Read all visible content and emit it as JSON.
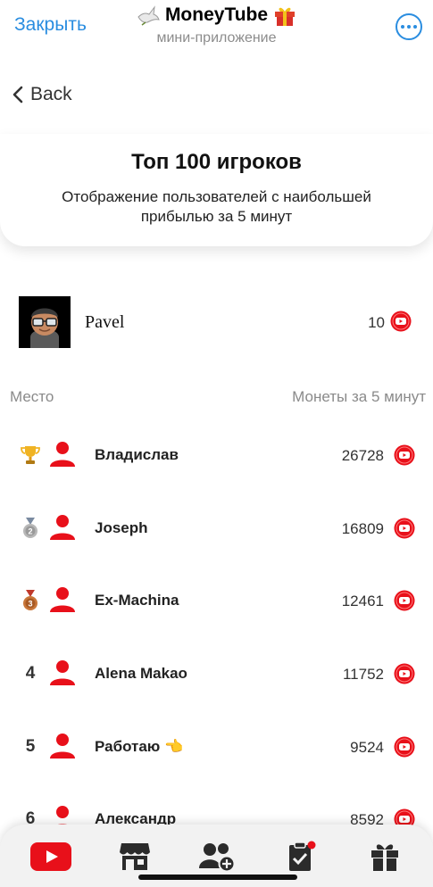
{
  "topbar": {
    "close_label": "Закрыть",
    "app_title": "MoneyTube",
    "app_subtitle": "мини-приложение"
  },
  "back_label": "Back",
  "hero": {
    "title": "Топ 100 игроков",
    "subtitle": "Отображение пользователей с наибольшей прибылью за 5 минут"
  },
  "current_user": {
    "name": "Pavel",
    "coins": "10"
  },
  "columns": {
    "left": "Место",
    "right": "Монеты за 5 минут"
  },
  "leaderboard": [
    {
      "rank": "",
      "medal": "gold-trophy",
      "name": "Владислав",
      "coins": "26728"
    },
    {
      "rank": "",
      "medal": "silver-medal",
      "name": "Joseph",
      "coins": "16809"
    },
    {
      "rank": "",
      "medal": "bronze-medal",
      "name": "Ex-Machina",
      "coins": "12461"
    },
    {
      "rank": "4",
      "medal": "",
      "name": "Alena Makao",
      "coins": "11752"
    },
    {
      "rank": "5",
      "medal": "",
      "name": "Работаю 👈",
      "coins": "9524"
    },
    {
      "rank": "6",
      "medal": "",
      "name": "Александр",
      "coins": "8592"
    }
  ],
  "tabs": [
    "youtube-icon",
    "shop-icon",
    "add-friends-icon",
    "tasks-icon",
    "gift-icon"
  ],
  "colors": {
    "accent_blue": "#2a8de0",
    "brand_red": "#e8101a",
    "gold": "#f0b323",
    "silver": "#9a9a9a",
    "bronze": "#b5652e"
  }
}
